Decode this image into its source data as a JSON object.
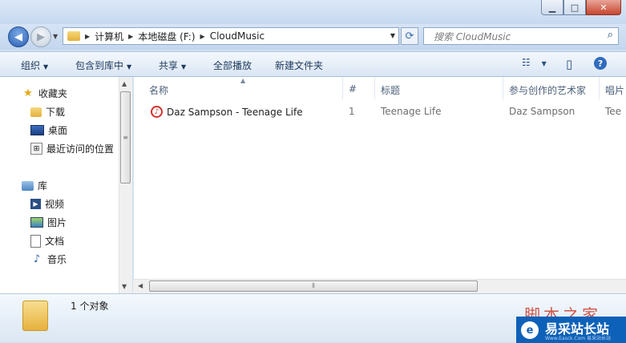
{
  "window": {
    "controls": {
      "minimize": "▁",
      "maximize": "□",
      "close": "✕"
    }
  },
  "nav": {
    "back_glyph": "◀",
    "forward_glyph": "▶",
    "dropdown_glyph": "▼",
    "breadcrumb": [
      "计算机",
      "本地磁盘 (F:)",
      "CloudMusic"
    ],
    "crumb_sep": "▶",
    "address_dropdown": "▼",
    "refresh_glyph": "⟳",
    "search_placeholder": "搜索 CloudMusic"
  },
  "toolbar": {
    "organize": "组织",
    "include_in_library": "包含到库中",
    "share": "共享",
    "play_all": "全部播放",
    "new_folder": "新建文件夹",
    "arrow": "▼",
    "view_glyph": "☷",
    "preview_glyph": "▯",
    "help_glyph": "?"
  },
  "sidebar": {
    "favorites": {
      "label": "收藏夹",
      "items": [
        "下载",
        "桌面",
        "最近访问的位置"
      ]
    },
    "libraries": {
      "label": "库",
      "items": [
        "视频",
        "图片",
        "文档",
        "音乐"
      ]
    }
  },
  "file_list": {
    "columns": [
      "名称",
      "#",
      "标题",
      "参与创作的艺术家",
      "唱片"
    ],
    "rows": [
      {
        "name": "Daz Sampson - Teenage Life",
        "track": "1",
        "title": "Teenage Life",
        "artist": "Daz Sampson",
        "album": "Tee"
      }
    ]
  },
  "status": {
    "text": "1 个对象"
  },
  "watermark": {
    "top": "脚本之家",
    "site": "易采站长站",
    "url": "Www.Easck.Com  易采站长站"
  },
  "colors": {
    "accent": "#2f6bbf",
    "window_bg": "#cfe0f3",
    "music_icon": "#d0342c",
    "watermark_box": "#0d61b8"
  }
}
